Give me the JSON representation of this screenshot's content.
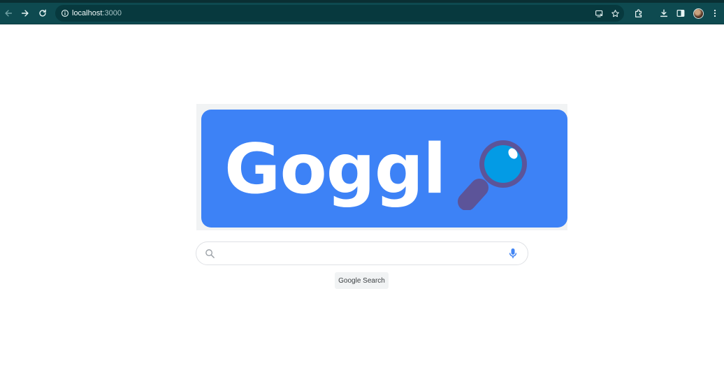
{
  "browser": {
    "url_host": "localhost",
    "url_port": ":3000",
    "icons": {
      "back": "back-arrow-icon",
      "forward": "forward-arrow-icon",
      "reload": "reload-icon",
      "site_info": "info-icon",
      "install": "install-app-icon",
      "bookmark": "star-icon",
      "extensions": "puzzle-icon",
      "downloads": "download-icon",
      "side_panel": "side-panel-icon",
      "profile": "avatar",
      "menu": "kebab-menu-icon"
    },
    "colors": {
      "toolbar": "#0e4a50",
      "omnibox": "#07393e"
    }
  },
  "page": {
    "logo_text": "Goggl",
    "search_placeholder": "",
    "search_value": "",
    "search_button_label": "Google Search",
    "colors": {
      "logo_card": "#3d82f6",
      "logo_text": "#ffffff",
      "glass_lens": "#039be5",
      "glass_frame": "#5c5499",
      "mic_blue": "#4285f4"
    }
  }
}
